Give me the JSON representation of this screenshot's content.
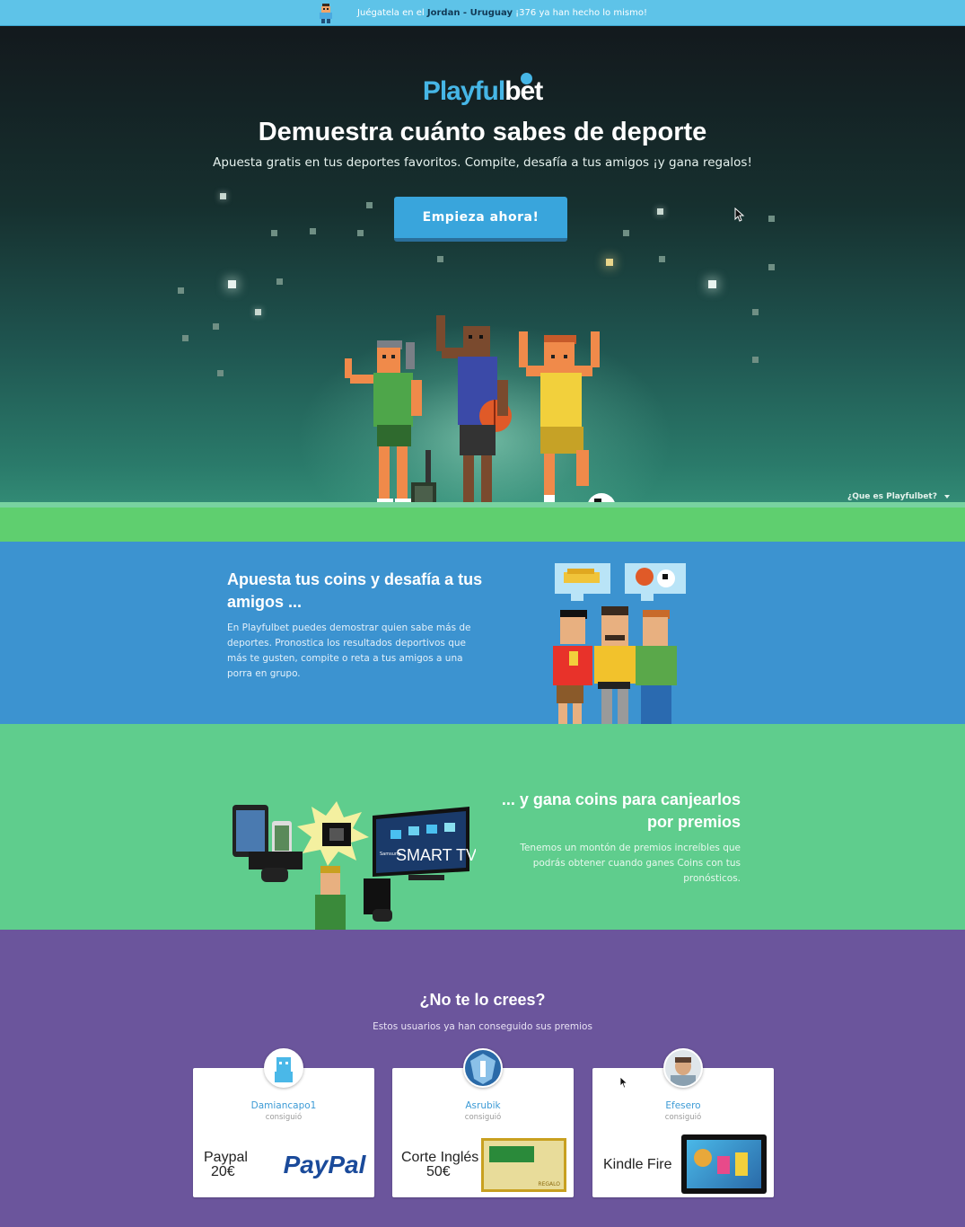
{
  "topbar": {
    "prefix": "Juégatela en el",
    "match": "Jordan - Uruguay",
    "suffix": "¡376 ya han hecho lo mismo!"
  },
  "hero": {
    "logo_part1": "Playful",
    "logo_part2": "bet",
    "title": "Demuestra cuánto sabes de deporte",
    "subtitle": "Apuesta gratis en tus deportes favoritos. Compite, desafía a tus amigos ¡y gana regalos!",
    "cta_label": "Empieza ahora!",
    "info_link": "¿Que es Playfulbet?"
  },
  "section_challenge": {
    "title": "Apuesta tus coins y desafía a tus amigos ...",
    "text": "En Playfulbet puedes demostrar quien sabe más de deportes. Pronostica los resultados deportivos que más te gusten, compite o reta a tus amigos a una porra en grupo."
  },
  "section_prizes": {
    "title": "... y gana coins para canjearlos por premios",
    "text": "Tenemos un montón de premios increíbles que podrás obtener cuando ganes Coins con tus pronósticos.",
    "tv_brand": "Samsung",
    "tv_label": "SMART TV"
  },
  "section_proof": {
    "title": "¿No te lo crees?",
    "subtitle": "Estos usuarios ya han conseguido sus premios",
    "cards": [
      {
        "user": "Damiancapo1",
        "got": "consiguió",
        "prize_line1": "Paypal",
        "prize_line2": "20€",
        "brand": "PayPal"
      },
      {
        "user": "Asrubik",
        "got": "consiguió",
        "prize_line1": "Corte Inglés",
        "prize_line2": "50€",
        "brand": "REGALO"
      },
      {
        "user": "Efesero",
        "got": "consiguió",
        "prize_line1": "Kindle Fire",
        "prize_line2": "",
        "brand": ""
      }
    ]
  },
  "colors": {
    "topbar": "#5ec3e8",
    "accent_blue": "#39a5dc",
    "section_blue": "#3c93d0",
    "section_green": "#5fcd8d",
    "section_purple": "#6b559c"
  }
}
